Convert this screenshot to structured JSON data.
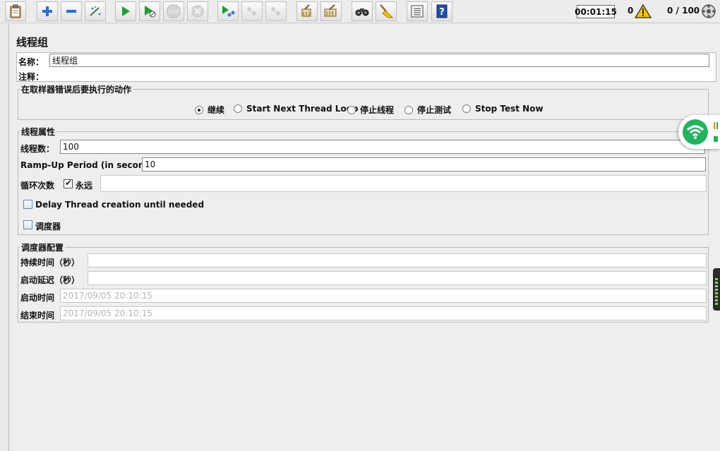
{
  "toolbar": {
    "buttons": [
      "templates",
      "add",
      "remove",
      "toggle",
      "start",
      "start-no-pauses",
      "stop",
      "shutdown",
      "remote-start",
      "remote-stop",
      "remote-shutdown",
      "clear",
      "clear-all",
      "search",
      "reset-search",
      "function-helper",
      "help"
    ],
    "timer": "00:01:15",
    "warnings": "0",
    "threads": "0 / 100"
  },
  "panel": {
    "title": "线程组",
    "name_label": "名称：",
    "name_value": "线程组",
    "comment_label": "注释：",
    "comment_value": ""
  },
  "sampler_error": {
    "legend": "在取样器错误后要执行的动作",
    "options": [
      "继续",
      "Start Next Thread Loop",
      "停止线程",
      "停止测试",
      "Stop Test Now"
    ],
    "selected": "继续"
  },
  "thread_props": {
    "legend": "线程属性",
    "threads_label": "线程数：",
    "threads_value": "100",
    "rampup_label": "Ramp-Up Period (in seconds):",
    "rampup_value": "10",
    "loop_label": "循环次数",
    "forever_label": "永远",
    "forever_checked": true,
    "loop_value": "",
    "delay_label": "Delay Thread creation until needed",
    "delay_checked": false,
    "scheduler_label": "调度器",
    "scheduler_checked": false
  },
  "scheduler": {
    "legend": "调度器配置",
    "duration_label": "持续时间（秒）",
    "duration_value": "",
    "delay_label": "启动延迟（秒）",
    "delay_value": "",
    "start_label": "启动时间",
    "start_value": "2017/09/05 20:10:15",
    "end_label": "结束时间",
    "end_value": "2017/09/05 20:10:15"
  },
  "colors": {
    "play_green": "#1e9e2e",
    "wifi_green": "#22b35e",
    "warning_yellow": "#f5c400"
  }
}
